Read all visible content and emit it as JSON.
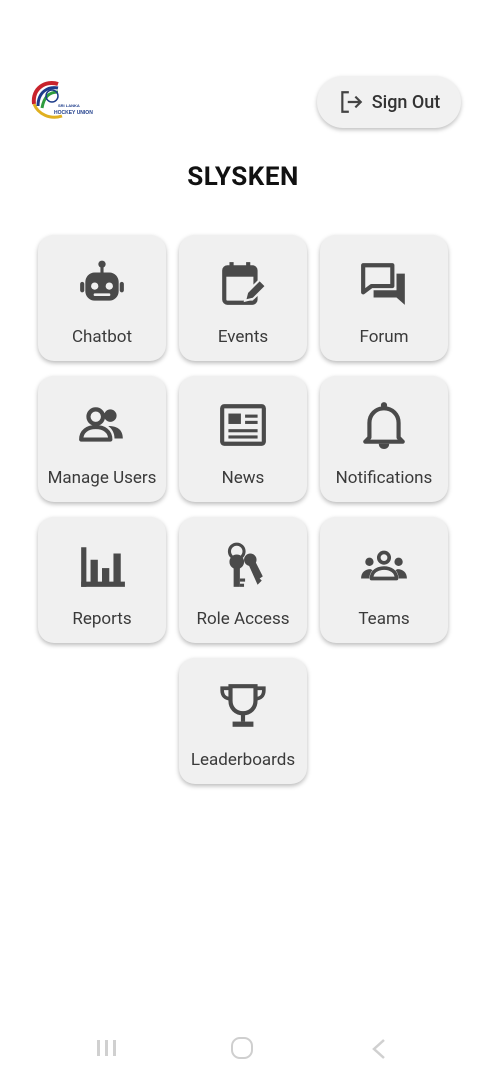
{
  "header": {
    "logo_text": "HOCKEY UNION",
    "logo_subtext": "SRI LANKA",
    "signout_label": "Sign Out"
  },
  "app_title": "SLYSKEN",
  "tiles": [
    {
      "label": "Chatbot",
      "icon": "robot-icon"
    },
    {
      "label": "Events",
      "icon": "calendar-edit-icon"
    },
    {
      "label": "Forum",
      "icon": "forum-icon"
    },
    {
      "label": "Manage Users",
      "icon": "users-icon"
    },
    {
      "label": "News",
      "icon": "newspaper-icon"
    },
    {
      "label": "Notifications",
      "icon": "bell-icon"
    },
    {
      "label": "Reports",
      "icon": "bar-chart-icon"
    },
    {
      "label": "Role Access",
      "icon": "keys-icon"
    },
    {
      "label": "Teams",
      "icon": "groups-icon"
    },
    {
      "label": "Leaderboards",
      "icon": "trophy-icon"
    }
  ]
}
